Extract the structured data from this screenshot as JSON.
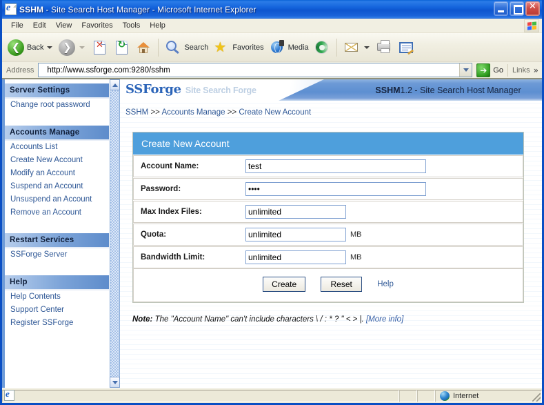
{
  "window": {
    "title_bold": "SSHM",
    "title_rest": " - Site Search Host Manager - Microsoft Internet Explorer",
    "icon": "ie-document-icon",
    "minimize_label": "Minimize",
    "maximize_label": "Maximize",
    "close_label": "Close"
  },
  "menubar": {
    "items": [
      {
        "label": "File"
      },
      {
        "label": "Edit"
      },
      {
        "label": "View"
      },
      {
        "label": "Favorites"
      },
      {
        "label": "Tools"
      },
      {
        "label": "Help"
      }
    ]
  },
  "toolbar": {
    "back_label": "Back",
    "forward_label": "",
    "stop_label": "",
    "refresh_label": "",
    "home_label": "",
    "search_label": "Search",
    "favorites_label": "Favorites",
    "media_label": "Media",
    "history_label": "",
    "mail_label": "",
    "print_label": "",
    "edit_label": ""
  },
  "address": {
    "label": "Address",
    "value": "http://www.ssforge.com:9280/sshm",
    "placeholder": "",
    "go_label": "Go",
    "links_label": "Links"
  },
  "sidebar": {
    "groups": [
      {
        "title": "Server Settings",
        "links": [
          {
            "label": "Change root password"
          }
        ]
      },
      {
        "title": "Accounts Manage",
        "links": [
          {
            "label": "Accounts List"
          },
          {
            "label": "Create New Account"
          },
          {
            "label": "Modify an Account"
          },
          {
            "label": "Suspend an Account"
          },
          {
            "label": "Unsuspend an Account"
          },
          {
            "label": "Remove an Account"
          }
        ]
      },
      {
        "title": "Restart Services",
        "links": [
          {
            "label": "SSForge Server"
          }
        ]
      },
      {
        "title": "Help",
        "links": [
          {
            "label": "Help Contents"
          },
          {
            "label": "Support Center"
          },
          {
            "label": "Register SSForge"
          }
        ]
      }
    ]
  },
  "banner": {
    "logo_main": "SSForge",
    "logo_sub": "Site Search Forge",
    "app_bold": "SSHM",
    "app_rest": " 1.2 - Site Search Host Manager"
  },
  "breadcrumb": {
    "item1": "SSHM",
    "sep1": ">>",
    "item2": "Accounts Manage",
    "sep2": ">>",
    "item3": "Create New Account"
  },
  "form": {
    "title": "Create New Account",
    "fields": [
      {
        "label": "Account Name:",
        "value": "test",
        "unit": ""
      },
      {
        "label": "Password:",
        "value": "••••",
        "unit": ""
      },
      {
        "label": "Max Index Files:",
        "value": "unlimited",
        "unit": ""
      },
      {
        "label": "Quota:",
        "value": "unlimited",
        "unit": "MB"
      },
      {
        "label": "Bandwidth Limit:",
        "value": "unlimited",
        "unit": "MB"
      }
    ],
    "create_label": "Create",
    "reset_label": "Reset",
    "help_label": "Help"
  },
  "note": {
    "prefix": "Note:",
    "text": " The \"Account Name\" can't include characters \\ / : * ? \" < > |.",
    "link": " [More info]"
  },
  "statusbar": {
    "message": "",
    "zone": "Internet"
  },
  "colors": {
    "title_blue": "#1565dd",
    "accent_blue": "#4e9fdc",
    "link_blue": "#2f5896",
    "logo_blue": "#2b64b8"
  }
}
